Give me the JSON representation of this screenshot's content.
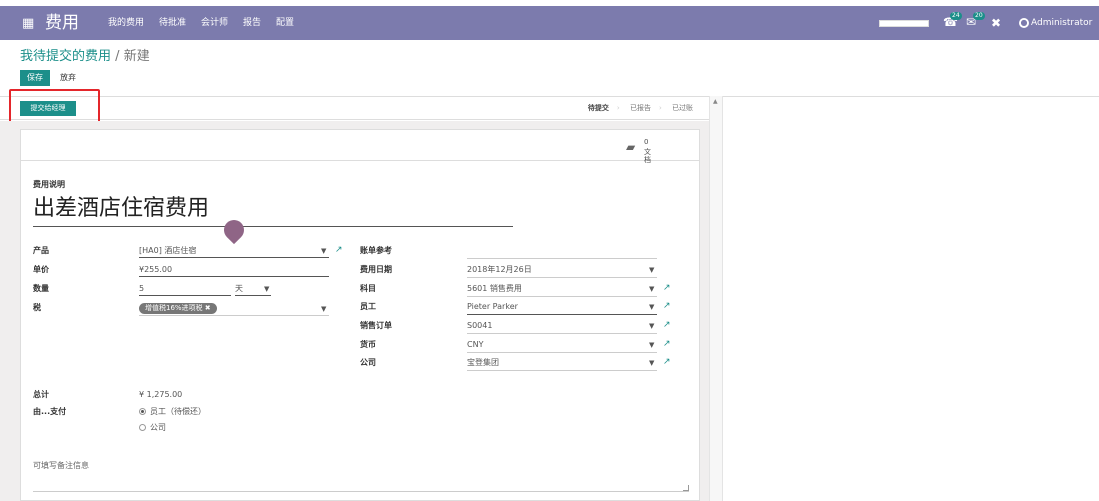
{
  "navbar": {
    "apps_icon": "grid-icon",
    "brand": "费用",
    "menu": [
      "我的费用",
      "待批准",
      "会计师",
      "报告",
      "配置"
    ],
    "badges": [
      {
        "icon": "phone-icon",
        "count": "24"
      },
      {
        "icon": "chat-icon",
        "count": "20"
      }
    ],
    "tools_icon": "close-tools-icon",
    "user": "Administrator"
  },
  "breadcrumb": {
    "parent": "我待提交的费用",
    "sep": "/",
    "current": "新建"
  },
  "buttons": {
    "save": "保存",
    "discard": "放弃",
    "submit": "提交给经理"
  },
  "stages": [
    "待提交",
    "已报告",
    "已过账"
  ],
  "docs": {
    "count": "0",
    "label": "文档"
  },
  "form": {
    "description_label": "费用说明",
    "description": "出差酒店住宿费用",
    "product": {
      "label": "产品",
      "value": "[HA0] 酒店住宿"
    },
    "unit_price": {
      "label": "单价",
      "value": "¥255.00"
    },
    "quantity": {
      "label": "数量",
      "value": "5",
      "uom": "天"
    },
    "tax": {
      "label": "税",
      "tag": "增值税16%进项税 ✖"
    },
    "reference": {
      "label": "账单参考",
      "value": ""
    },
    "date": {
      "label": "费用日期",
      "value": "2018年12月26日"
    },
    "account": {
      "label": "科目",
      "value": "5601 销售费用"
    },
    "employee": {
      "label": "员工",
      "value": "Pieter Parker"
    },
    "sale_order": {
      "label": "销售订单",
      "value": "S0041"
    },
    "currency": {
      "label": "货币",
      "value": "CNY"
    },
    "company": {
      "label": "公司",
      "value": "宝登集团"
    },
    "total": {
      "label": "总计",
      "value": "¥ 1,275.00"
    },
    "paid_by": {
      "label": "由...支付",
      "options": [
        "员工（待偿还）",
        "公司"
      ],
      "selected": 0
    },
    "notes_placeholder": "可填写备注信息"
  }
}
